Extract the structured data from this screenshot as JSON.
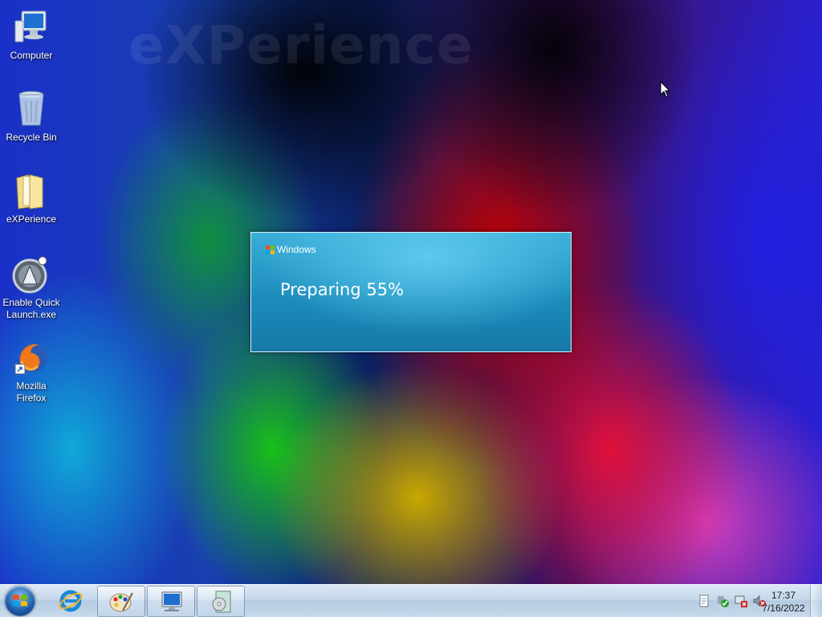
{
  "wallpaper": {
    "watermark": "eXPerience"
  },
  "desktop_icons": [
    {
      "label": "Computer",
      "icon": "computer-icon"
    },
    {
      "label": "Recycle Bin",
      "icon": "recycle-bin-icon"
    },
    {
      "label": "eXPerience",
      "icon": "folder-icon"
    },
    {
      "label": "Enable Quick Launch.exe",
      "icon": "launcher-app-icon"
    },
    {
      "label": "Mozilla Firefox",
      "icon": "firefox-icon"
    }
  ],
  "dialog": {
    "brand": "Windows",
    "status": "Preparing 55%",
    "progress_percent": 55
  },
  "taskbar": {
    "start_icon": "windows-orb-icon",
    "pinned": [
      "internet-explorer-icon"
    ],
    "buttons": [
      "paint-palette-icon",
      "computer-window-icon",
      "media-disc-icon"
    ],
    "tray_icons": [
      "notes-tray-icon",
      "security-check-tray-icon",
      "network-error-tray-icon",
      "volume-muted-tray-icon"
    ],
    "clock": {
      "time": "17:37",
      "date": "7/16/2022"
    }
  },
  "colors": {
    "dialog_bg": "#1c8cbc",
    "taskbar_bg": "#c5d8ea"
  }
}
